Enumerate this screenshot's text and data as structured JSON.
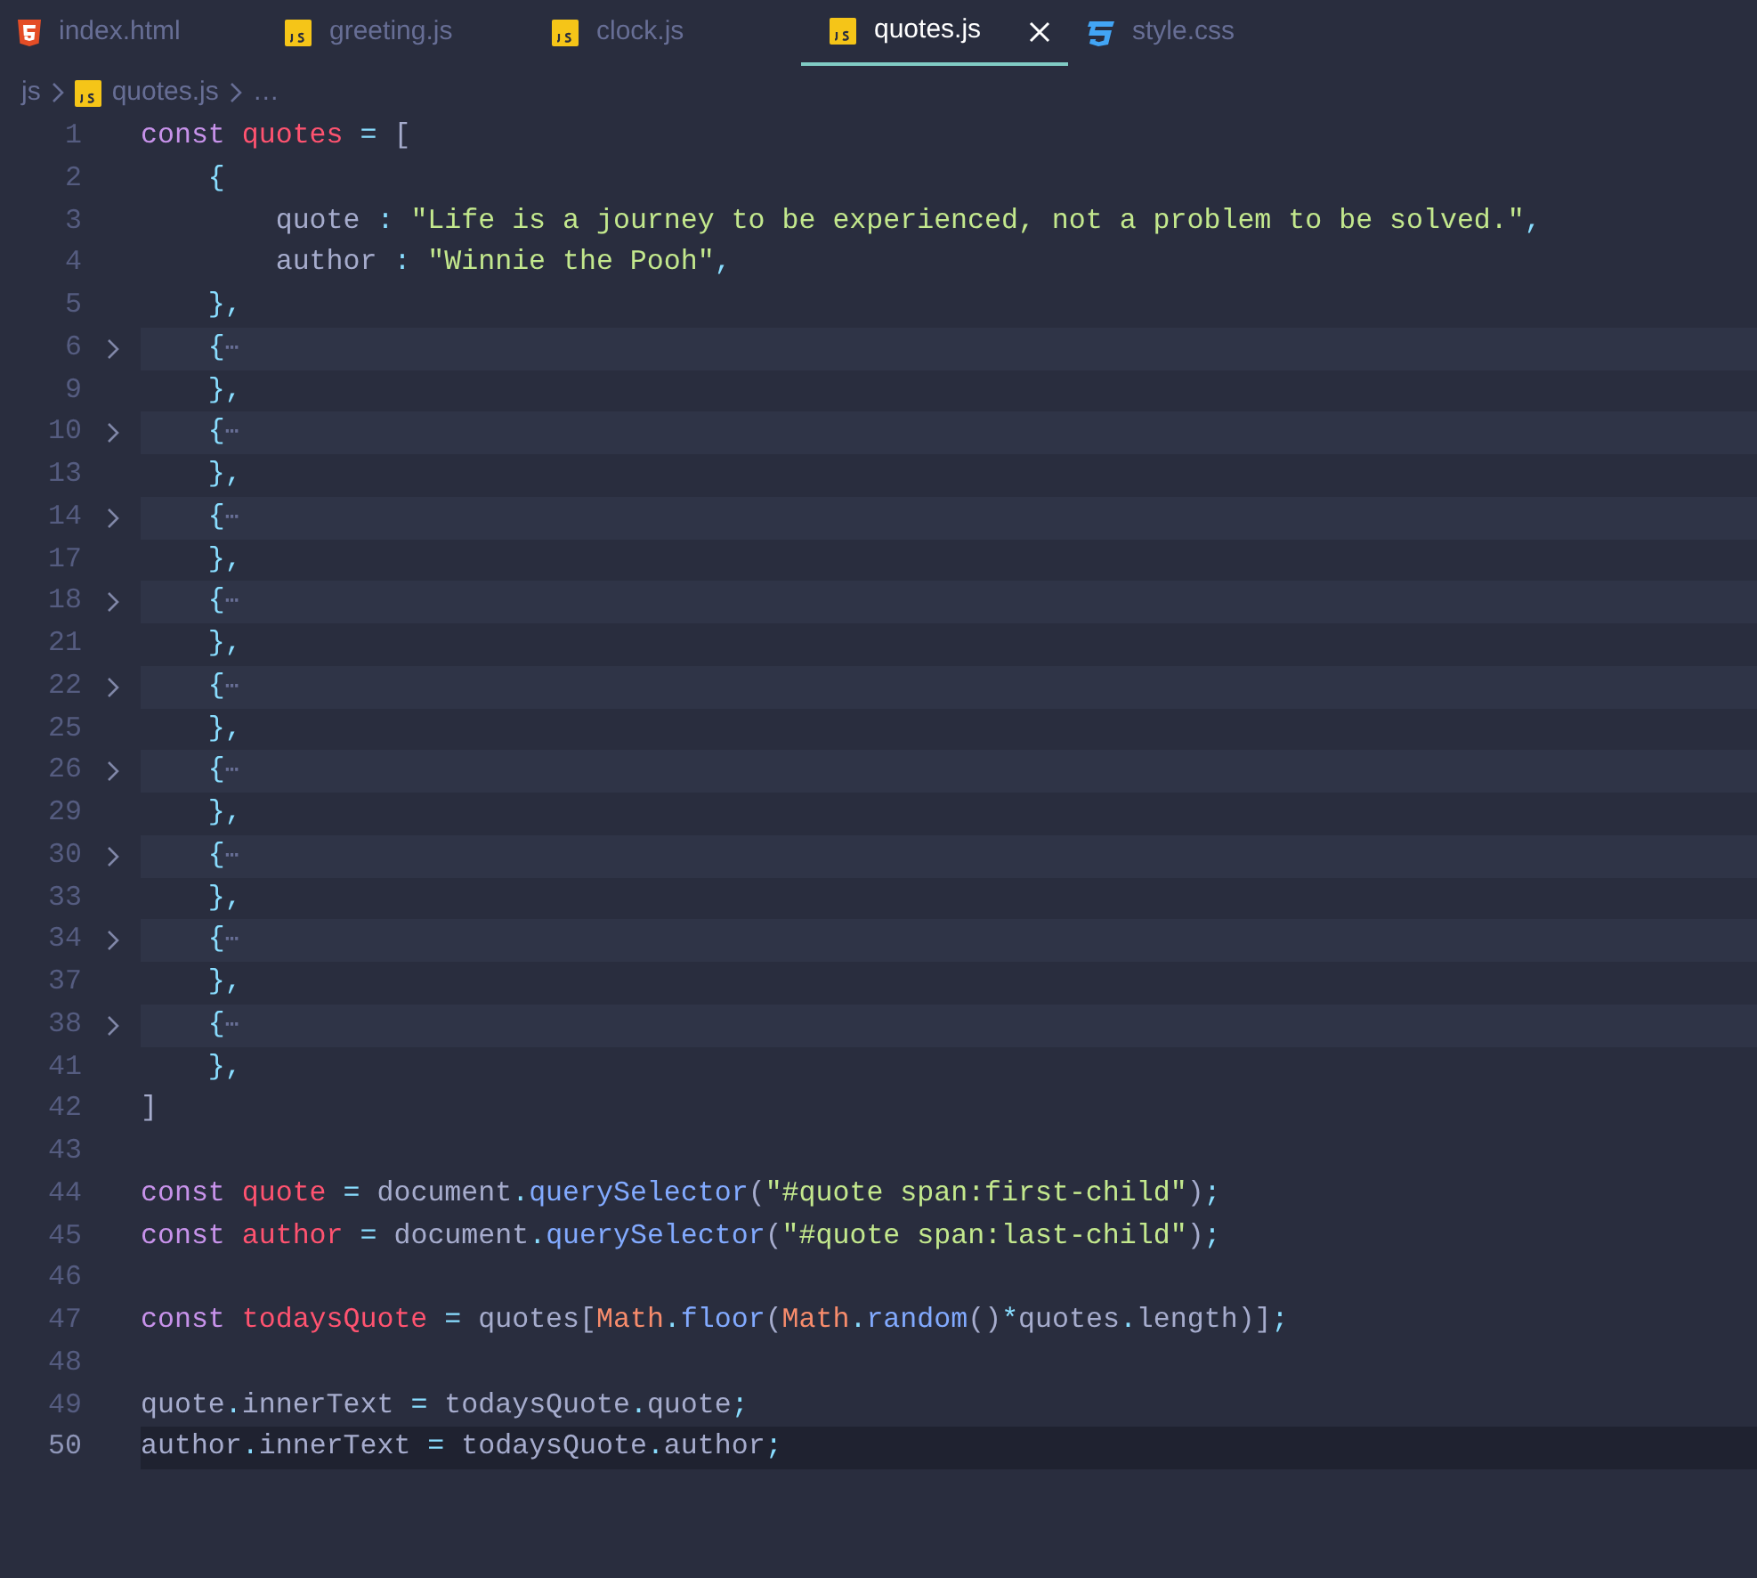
{
  "tabs": [
    {
      "label": "index.html",
      "kind": "html",
      "selected": false
    },
    {
      "label": "greeting.js",
      "kind": "js",
      "selected": false
    },
    {
      "label": "clock.js",
      "kind": "js",
      "selected": false
    },
    {
      "label": "quotes.js",
      "kind": "js",
      "selected": true
    },
    {
      "label": "style.css",
      "kind": "css",
      "selected": false
    }
  ],
  "breadcrumb": {
    "folder": "js",
    "file": "quotes.js",
    "symbol": "…"
  },
  "lines": [
    {
      "number": "1",
      "tokens": [
        {
          "text": "const ",
          "kind": "keyword"
        },
        {
          "text": "quotes",
          "kind": "var"
        },
        {
          "text": " = ",
          "kind": "op"
        },
        {
          "text": "[",
          "kind": "bracket"
        }
      ]
    },
    {
      "number": "2",
      "tokens": [
        {
          "text": "    {",
          "kind": "op"
        }
      ]
    },
    {
      "number": "3",
      "tokens": [
        {
          "text": "        quote",
          "kind": "prop"
        },
        {
          "text": " : ",
          "kind": "op"
        },
        {
          "text": "\"Life is a journey to be experienced, not a problem to be solved.\"",
          "kind": "string"
        },
        {
          "text": ",",
          "kind": "op"
        }
      ]
    },
    {
      "number": "4",
      "tokens": [
        {
          "text": "        author",
          "kind": "prop"
        },
        {
          "text": " : ",
          "kind": "op"
        },
        {
          "text": "\"Winnie the Pooh\"",
          "kind": "string"
        },
        {
          "text": ",",
          "kind": "op"
        }
      ]
    },
    {
      "number": "5",
      "tokens": [
        {
          "text": "    },",
          "kind": "op"
        }
      ]
    },
    {
      "number": "6",
      "folded": true,
      "tokens": [
        {
          "text": "    {",
          "kind": "op"
        },
        {
          "text": "⋯",
          "kind": "fold"
        }
      ]
    },
    {
      "number": "9",
      "tokens": [
        {
          "text": "    },",
          "kind": "op"
        }
      ]
    },
    {
      "number": "10",
      "folded": true,
      "tokens": [
        {
          "text": "    {",
          "kind": "op"
        },
        {
          "text": "⋯",
          "kind": "fold"
        }
      ]
    },
    {
      "number": "13",
      "tokens": [
        {
          "text": "    },",
          "kind": "op"
        }
      ]
    },
    {
      "number": "14",
      "folded": true,
      "tokens": [
        {
          "text": "    {",
          "kind": "op"
        },
        {
          "text": "⋯",
          "kind": "fold"
        }
      ]
    },
    {
      "number": "17",
      "tokens": [
        {
          "text": "    },",
          "kind": "op"
        }
      ]
    },
    {
      "number": "18",
      "folded": true,
      "tokens": [
        {
          "text": "    {",
          "kind": "op"
        },
        {
          "text": "⋯",
          "kind": "fold"
        }
      ]
    },
    {
      "number": "21",
      "tokens": [
        {
          "text": "    },",
          "kind": "op"
        }
      ]
    },
    {
      "number": "22",
      "folded": true,
      "tokens": [
        {
          "text": "    {",
          "kind": "op"
        },
        {
          "text": "⋯",
          "kind": "fold"
        }
      ]
    },
    {
      "number": "25",
      "tokens": [
        {
          "text": "    },",
          "kind": "op"
        }
      ]
    },
    {
      "number": "26",
      "folded": true,
      "tokens": [
        {
          "text": "    {",
          "kind": "op"
        },
        {
          "text": "⋯",
          "kind": "fold"
        }
      ]
    },
    {
      "number": "29",
      "tokens": [
        {
          "text": "    },",
          "kind": "op"
        }
      ]
    },
    {
      "number": "30",
      "folded": true,
      "tokens": [
        {
          "text": "    {",
          "kind": "op"
        },
        {
          "text": "⋯",
          "kind": "fold"
        }
      ]
    },
    {
      "number": "33",
      "tokens": [
        {
          "text": "    },",
          "kind": "op"
        }
      ]
    },
    {
      "number": "34",
      "folded": true,
      "tokens": [
        {
          "text": "    {",
          "kind": "op"
        },
        {
          "text": "⋯",
          "kind": "fold"
        }
      ]
    },
    {
      "number": "37",
      "tokens": [
        {
          "text": "    },",
          "kind": "op"
        }
      ]
    },
    {
      "number": "38",
      "folded": true,
      "tokens": [
        {
          "text": "    {",
          "kind": "op"
        },
        {
          "text": "⋯",
          "kind": "fold"
        }
      ]
    },
    {
      "number": "41",
      "tokens": [
        {
          "text": "    },",
          "kind": "op"
        }
      ]
    },
    {
      "number": "42",
      "tokens": [
        {
          "text": "]",
          "kind": "bracket"
        }
      ]
    },
    {
      "number": "43"
    },
    {
      "number": "44",
      "tokens": [
        {
          "text": "const ",
          "kind": "keyword"
        },
        {
          "text": "quote",
          "kind": "var"
        },
        {
          "text": " = ",
          "kind": "op"
        },
        {
          "text": "document",
          "kind": "plain"
        },
        {
          "text": ".",
          "kind": "op"
        },
        {
          "text": "querySelector",
          "kind": "method"
        },
        {
          "text": "(",
          "kind": "bracket"
        },
        {
          "text": "\"#quote span:first-child\"",
          "kind": "string"
        },
        {
          "text": ")",
          "kind": "bracket"
        },
        {
          "text": ";",
          "kind": "op"
        }
      ]
    },
    {
      "number": "45",
      "tokens": [
        {
          "text": "const ",
          "kind": "keyword"
        },
        {
          "text": "author",
          "kind": "var"
        },
        {
          "text": " = ",
          "kind": "op"
        },
        {
          "text": "document",
          "kind": "plain"
        },
        {
          "text": ".",
          "kind": "op"
        },
        {
          "text": "querySelector",
          "kind": "method"
        },
        {
          "text": "(",
          "kind": "bracket"
        },
        {
          "text": "\"#quote span:last-child\"",
          "kind": "string"
        },
        {
          "text": ")",
          "kind": "bracket"
        },
        {
          "text": ";",
          "kind": "op"
        }
      ]
    },
    {
      "number": "46"
    },
    {
      "number": "47",
      "tokens": [
        {
          "text": "const ",
          "kind": "keyword"
        },
        {
          "text": "todaysQuote",
          "kind": "var"
        },
        {
          "text": " = ",
          "kind": "op"
        },
        {
          "text": "quotes",
          "kind": "plain"
        },
        {
          "text": "[",
          "kind": "bracket"
        },
        {
          "text": "Math",
          "kind": "builtin"
        },
        {
          "text": ".",
          "kind": "op"
        },
        {
          "text": "floor",
          "kind": "method"
        },
        {
          "text": "(",
          "kind": "bracket"
        },
        {
          "text": "Math",
          "kind": "builtin"
        },
        {
          "text": ".",
          "kind": "op"
        },
        {
          "text": "random",
          "kind": "method"
        },
        {
          "text": "()",
          "kind": "bracket"
        },
        {
          "text": "*",
          "kind": "op"
        },
        {
          "text": "quotes",
          "kind": "plain"
        },
        {
          "text": ".",
          "kind": "op"
        },
        {
          "text": "length",
          "kind": "plain"
        },
        {
          "text": ")]",
          "kind": "bracket"
        },
        {
          "text": ";",
          "kind": "op"
        }
      ]
    },
    {
      "number": "48"
    },
    {
      "number": "49",
      "tokens": [
        {
          "text": "quote",
          "kind": "plain"
        },
        {
          "text": ".",
          "kind": "op"
        },
        {
          "text": "innerText",
          "kind": "plain"
        },
        {
          "text": " = ",
          "kind": "op"
        },
        {
          "text": "todaysQuote",
          "kind": "plain"
        },
        {
          "text": ".",
          "kind": "op"
        },
        {
          "text": "quote",
          "kind": "plain"
        },
        {
          "text": ";",
          "kind": "op"
        }
      ]
    },
    {
      "number": "50",
      "current": true,
      "tokens": [
        {
          "text": "author",
          "kind": "plain"
        },
        {
          "text": ".",
          "kind": "op"
        },
        {
          "text": "innerText",
          "kind": "plain"
        },
        {
          "text": " = ",
          "kind": "op"
        },
        {
          "text": "todaysQuote",
          "kind": "plain"
        },
        {
          "text": ".",
          "kind": "op"
        },
        {
          "text": "author",
          "kind": "plain"
        },
        {
          "text": ";",
          "kind": "op"
        }
      ]
    }
  ]
}
